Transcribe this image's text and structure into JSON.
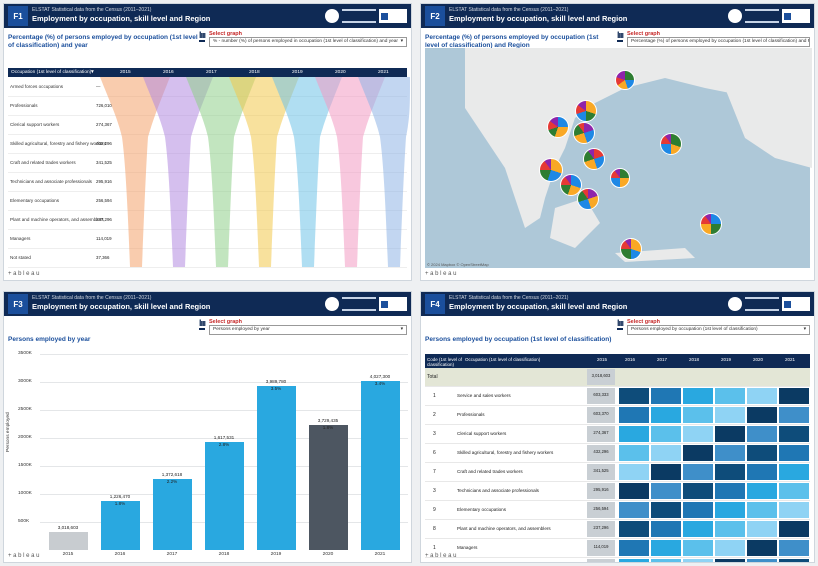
{
  "common": {
    "header_subtitle": "ELSTAT Statistical data from the Census (2011–2021)",
    "header_title": "Employment by occupation, skill level and Region",
    "select_label": "Select graph",
    "footer": "+ a b l e a u"
  },
  "panel1": {
    "badge": "F1",
    "title": "Percentage (%) of persons employed by occupation (1st level of classification) and year",
    "select_value": "% - number (%) of persons employed in occupation (1st level of classification) and year",
    "table_header": "Occupation (1st level of classification)",
    "years": [
      "2015",
      "2016",
      "2017",
      "2018",
      "2019",
      "2020",
      "2021"
    ],
    "rows": [
      {
        "label": "Armed forces occupations",
        "value": "—"
      },
      {
        "label": "Professionals",
        "value": "726,010"
      },
      {
        "label": "Clerical support workers",
        "value": "274,367"
      },
      {
        "label": "Skilled agricultural, forestry and fishery workers",
        "value": "432,296"
      },
      {
        "label": "Craft and related trades workers",
        "value": "341,525"
      },
      {
        "label": "Technicians and associate professionals",
        "value": "295,916"
      },
      {
        "label": "Elementary occupations",
        "value": "256,594"
      },
      {
        "label": "Plant and machine operators, and assemblers",
        "value": "237,296"
      },
      {
        "label": "Managers",
        "value": "114,019"
      },
      {
        "label": "Not stated",
        "value": "37,366"
      }
    ]
  },
  "panel2": {
    "badge": "F2",
    "title": "Percentage (%) of persons employed by occupation (1st level of classification) and Region",
    "select_value": "Percentage (%) of persons employed by occupation (1st level of classification) and Region",
    "attribution": "© 2024 Mapbox © OpenStreetMap"
  },
  "panel3": {
    "badge": "F3",
    "title": "Persons employed by year",
    "select_value": "Persons employed by year",
    "y_axis_label": "Persons employed",
    "y_ticks": [
      "3500K",
      "3000K",
      "2500K",
      "2000K",
      "1500K",
      "1000K",
      "500K"
    ]
  },
  "chart_data": {
    "type": "bar",
    "categories": [
      "2015",
      "2016",
      "2017",
      "2018",
      "2019",
      "2020",
      "2021"
    ],
    "values": [
      3018603,
      3226470,
      3372618,
      3617531,
      3989780,
      3729435,
      4027300
    ],
    "labels": [
      "3,018,603",
      "1,226,470",
      "1,372,618",
      "1,617,531",
      "3,989,780",
      "3,729,435",
      "4,027,300"
    ],
    "pct_labels": [
      "",
      "1.8%",
      "2.2%",
      "2.8%",
      "3.5%",
      "1.8%",
      "3.4%"
    ],
    "ylim": [
      2900000,
      4100000
    ],
    "colors": [
      "#c8ccd0",
      "#29a8e0",
      "#29a8e0",
      "#29a8e0",
      "#29a8e0",
      "#4d5661",
      "#29a8e0"
    ]
  },
  "panel4": {
    "badge": "F4",
    "title": "Persons employed by occupation (1st level of classification)",
    "select_value": "Persons employed by occupation (1st level of classification)",
    "header_code": "Code (1st level of classification)",
    "header_occupation": "Occupation (1st level of classification)",
    "years": [
      "2015",
      "2016",
      "2017",
      "2018",
      "2019",
      "2020",
      "2021"
    ],
    "total_label": "Total",
    "total_value": "3,018,603",
    "rows": [
      {
        "code": "1",
        "label": "Service and sales workers",
        "value": "603,333"
      },
      {
        "code": "2",
        "label": "Professionals",
        "value": "603,370"
      },
      {
        "code": "3",
        "label": "Clerical support workers",
        "value": "274,367"
      },
      {
        "code": "6",
        "label": "Skilled agricultural, forestry and fishery workers",
        "value": "432,296"
      },
      {
        "code": "7",
        "label": "Craft and related trades workers",
        "value": "341,525"
      },
      {
        "code": "3",
        "label": "Technicians and associate professionals",
        "value": "295,916"
      },
      {
        "code": "9",
        "label": "Elementary occupations",
        "value": "256,594"
      },
      {
        "code": "8",
        "label": "Plant and machine operators, and assemblers",
        "value": "237,296"
      },
      {
        "code": "1",
        "label": "Managers",
        "value": "114,019"
      },
      {
        "code": "X",
        "label": "Not stated",
        "value": "37,366"
      }
    ]
  }
}
